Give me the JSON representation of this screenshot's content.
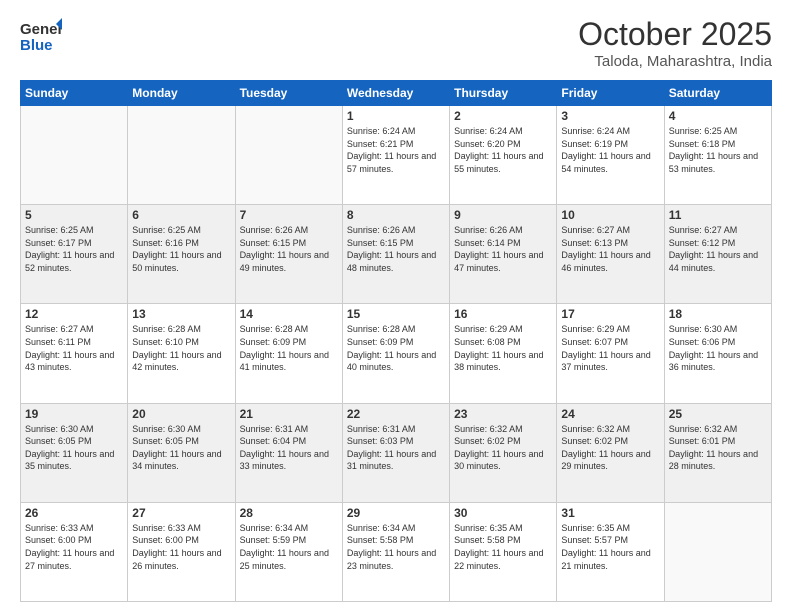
{
  "header": {
    "logo_general": "General",
    "logo_blue": "Blue",
    "month": "October 2025",
    "location": "Taloda, Maharashtra, India"
  },
  "weekdays": [
    "Sunday",
    "Monday",
    "Tuesday",
    "Wednesday",
    "Thursday",
    "Friday",
    "Saturday"
  ],
  "weeks": [
    [
      {
        "day": "",
        "sunrise": "",
        "sunset": "",
        "daylight": ""
      },
      {
        "day": "",
        "sunrise": "",
        "sunset": "",
        "daylight": ""
      },
      {
        "day": "",
        "sunrise": "",
        "sunset": "",
        "daylight": ""
      },
      {
        "day": "1",
        "sunrise": "Sunrise: 6:24 AM",
        "sunset": "Sunset: 6:21 PM",
        "daylight": "Daylight: 11 hours and 57 minutes."
      },
      {
        "day": "2",
        "sunrise": "Sunrise: 6:24 AM",
        "sunset": "Sunset: 6:20 PM",
        "daylight": "Daylight: 11 hours and 55 minutes."
      },
      {
        "day": "3",
        "sunrise": "Sunrise: 6:24 AM",
        "sunset": "Sunset: 6:19 PM",
        "daylight": "Daylight: 11 hours and 54 minutes."
      },
      {
        "day": "4",
        "sunrise": "Sunrise: 6:25 AM",
        "sunset": "Sunset: 6:18 PM",
        "daylight": "Daylight: 11 hours and 53 minutes."
      }
    ],
    [
      {
        "day": "5",
        "sunrise": "Sunrise: 6:25 AM",
        "sunset": "Sunset: 6:17 PM",
        "daylight": "Daylight: 11 hours and 52 minutes."
      },
      {
        "day": "6",
        "sunrise": "Sunrise: 6:25 AM",
        "sunset": "Sunset: 6:16 PM",
        "daylight": "Daylight: 11 hours and 50 minutes."
      },
      {
        "day": "7",
        "sunrise": "Sunrise: 6:26 AM",
        "sunset": "Sunset: 6:15 PM",
        "daylight": "Daylight: 11 hours and 49 minutes."
      },
      {
        "day": "8",
        "sunrise": "Sunrise: 6:26 AM",
        "sunset": "Sunset: 6:15 PM",
        "daylight": "Daylight: 11 hours and 48 minutes."
      },
      {
        "day": "9",
        "sunrise": "Sunrise: 6:26 AM",
        "sunset": "Sunset: 6:14 PM",
        "daylight": "Daylight: 11 hours and 47 minutes."
      },
      {
        "day": "10",
        "sunrise": "Sunrise: 6:27 AM",
        "sunset": "Sunset: 6:13 PM",
        "daylight": "Daylight: 11 hours and 46 minutes."
      },
      {
        "day": "11",
        "sunrise": "Sunrise: 6:27 AM",
        "sunset": "Sunset: 6:12 PM",
        "daylight": "Daylight: 11 hours and 44 minutes."
      }
    ],
    [
      {
        "day": "12",
        "sunrise": "Sunrise: 6:27 AM",
        "sunset": "Sunset: 6:11 PM",
        "daylight": "Daylight: 11 hours and 43 minutes."
      },
      {
        "day": "13",
        "sunrise": "Sunrise: 6:28 AM",
        "sunset": "Sunset: 6:10 PM",
        "daylight": "Daylight: 11 hours and 42 minutes."
      },
      {
        "day": "14",
        "sunrise": "Sunrise: 6:28 AM",
        "sunset": "Sunset: 6:09 PM",
        "daylight": "Daylight: 11 hours and 41 minutes."
      },
      {
        "day": "15",
        "sunrise": "Sunrise: 6:28 AM",
        "sunset": "Sunset: 6:09 PM",
        "daylight": "Daylight: 11 hours and 40 minutes."
      },
      {
        "day": "16",
        "sunrise": "Sunrise: 6:29 AM",
        "sunset": "Sunset: 6:08 PM",
        "daylight": "Daylight: 11 hours and 38 minutes."
      },
      {
        "day": "17",
        "sunrise": "Sunrise: 6:29 AM",
        "sunset": "Sunset: 6:07 PM",
        "daylight": "Daylight: 11 hours and 37 minutes."
      },
      {
        "day": "18",
        "sunrise": "Sunrise: 6:30 AM",
        "sunset": "Sunset: 6:06 PM",
        "daylight": "Daylight: 11 hours and 36 minutes."
      }
    ],
    [
      {
        "day": "19",
        "sunrise": "Sunrise: 6:30 AM",
        "sunset": "Sunset: 6:05 PM",
        "daylight": "Daylight: 11 hours and 35 minutes."
      },
      {
        "day": "20",
        "sunrise": "Sunrise: 6:30 AM",
        "sunset": "Sunset: 6:05 PM",
        "daylight": "Daylight: 11 hours and 34 minutes."
      },
      {
        "day": "21",
        "sunrise": "Sunrise: 6:31 AM",
        "sunset": "Sunset: 6:04 PM",
        "daylight": "Daylight: 11 hours and 33 minutes."
      },
      {
        "day": "22",
        "sunrise": "Sunrise: 6:31 AM",
        "sunset": "Sunset: 6:03 PM",
        "daylight": "Daylight: 11 hours and 31 minutes."
      },
      {
        "day": "23",
        "sunrise": "Sunrise: 6:32 AM",
        "sunset": "Sunset: 6:02 PM",
        "daylight": "Daylight: 11 hours and 30 minutes."
      },
      {
        "day": "24",
        "sunrise": "Sunrise: 6:32 AM",
        "sunset": "Sunset: 6:02 PM",
        "daylight": "Daylight: 11 hours and 29 minutes."
      },
      {
        "day": "25",
        "sunrise": "Sunrise: 6:32 AM",
        "sunset": "Sunset: 6:01 PM",
        "daylight": "Daylight: 11 hours and 28 minutes."
      }
    ],
    [
      {
        "day": "26",
        "sunrise": "Sunrise: 6:33 AM",
        "sunset": "Sunset: 6:00 PM",
        "daylight": "Daylight: 11 hours and 27 minutes."
      },
      {
        "day": "27",
        "sunrise": "Sunrise: 6:33 AM",
        "sunset": "Sunset: 6:00 PM",
        "daylight": "Daylight: 11 hours and 26 minutes."
      },
      {
        "day": "28",
        "sunrise": "Sunrise: 6:34 AM",
        "sunset": "Sunset: 5:59 PM",
        "daylight": "Daylight: 11 hours and 25 minutes."
      },
      {
        "day": "29",
        "sunrise": "Sunrise: 6:34 AM",
        "sunset": "Sunset: 5:58 PM",
        "daylight": "Daylight: 11 hours and 23 minutes."
      },
      {
        "day": "30",
        "sunrise": "Sunrise: 6:35 AM",
        "sunset": "Sunset: 5:58 PM",
        "daylight": "Daylight: 11 hours and 22 minutes."
      },
      {
        "day": "31",
        "sunrise": "Sunrise: 6:35 AM",
        "sunset": "Sunset: 5:57 PM",
        "daylight": "Daylight: 11 hours and 21 minutes."
      },
      {
        "day": "",
        "sunrise": "",
        "sunset": "",
        "daylight": ""
      }
    ]
  ]
}
